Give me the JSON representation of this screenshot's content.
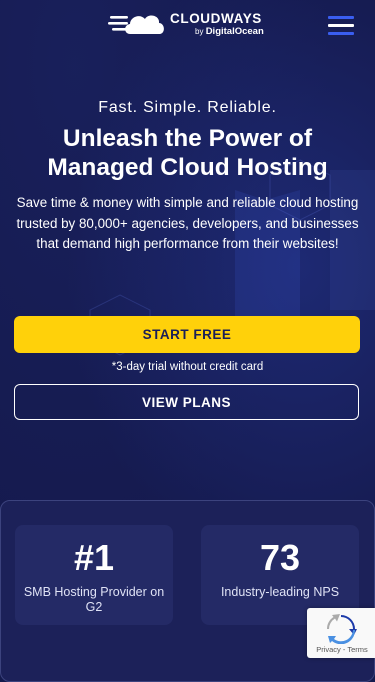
{
  "header": {
    "brand_name": "CLOUDWAYS",
    "brand_by": "by",
    "brand_partner": "DigitalOcean",
    "logo_icon": "cloud-speed-icon",
    "menu_icon": "hamburger-menu-icon"
  },
  "hero": {
    "tagline": "Fast. Simple. Reliable.",
    "headline": "Unleash the Power of Managed Cloud Hosting",
    "description": "Save time & money with simple and reliable cloud hosting trusted by 80,000+ agencies, developers, and businesses that demand high performance from their websites!",
    "start_button": "START FREE",
    "trial_note": "*3-day trial without credit card",
    "plans_button": "VIEW PLANS"
  },
  "stats": [
    {
      "value": "#1",
      "label": "SMB Hosting Provider on G2"
    },
    {
      "value": "73",
      "label": "Industry-leading NPS"
    }
  ],
  "recaptcha": {
    "icon": "recaptcha-icon",
    "privacy": "Privacy",
    "separator": " - ",
    "terms": "Terms"
  },
  "colors": {
    "background": "#151a4e",
    "primary_button": "#ffd10a",
    "primary_button_text": "#1a1f58",
    "accent": "#3a5ef0"
  }
}
